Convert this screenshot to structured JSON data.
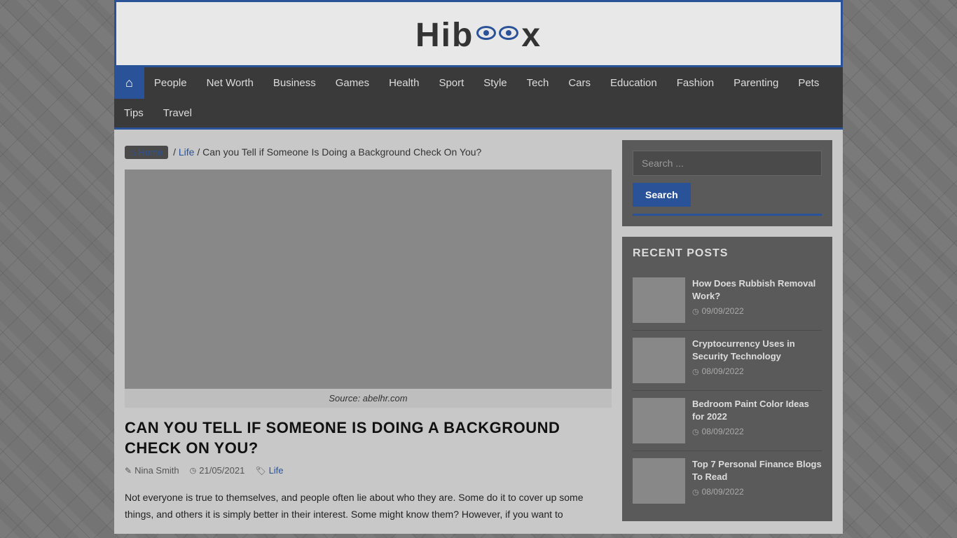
{
  "site": {
    "name_before": "Hib",
    "name_after": "x",
    "tagline": "Hiboox"
  },
  "nav": {
    "home_label": "Home",
    "items": [
      {
        "label": "People",
        "href": "#"
      },
      {
        "label": "Net Worth",
        "href": "#"
      },
      {
        "label": "Business",
        "href": "#"
      },
      {
        "label": "Games",
        "href": "#"
      },
      {
        "label": "Health",
        "href": "#"
      },
      {
        "label": "Sport",
        "href": "#"
      },
      {
        "label": "Style",
        "href": "#"
      },
      {
        "label": "Tech",
        "href": "#"
      },
      {
        "label": "Cars",
        "href": "#"
      },
      {
        "label": "Education",
        "href": "#"
      },
      {
        "label": "Fashion",
        "href": "#"
      },
      {
        "label": "Parenting",
        "href": "#"
      },
      {
        "label": "Pets",
        "href": "#"
      },
      {
        "label": "Tips",
        "href": "#"
      },
      {
        "label": "Travel",
        "href": "#"
      }
    ]
  },
  "breadcrumb": {
    "home": "Home",
    "category": "Life",
    "page": "Can you Tell if Someone Is Doing a Background Check On You?"
  },
  "article": {
    "title": "Can You Tell If Someone Is Doing A Background Check On You?",
    "image_caption": "Source: abelhr.com",
    "author": "Nina Smith",
    "date": "21/05/2021",
    "category": "Life",
    "excerpt": "Not everyone is true to themselves, and people often lie about who they are. Some do it to cover up some things, and others it is simply better in their interest. Some might know them? However, if you want to"
  },
  "sidebar": {
    "search": {
      "placeholder": "Search ...",
      "button_label": "Search"
    },
    "recent_posts": {
      "title": "Recent Posts",
      "items": [
        {
          "title": "How Does Rubbish Removal Work?",
          "date": "09/09/2022"
        },
        {
          "title": "Cryptocurrency Uses in Security Technology",
          "date": "08/09/2022"
        },
        {
          "title": "Bedroom Paint Color Ideas for 2022",
          "date": "08/09/2022"
        },
        {
          "title": "Top 7 Personal Finance Blogs To Read",
          "date": "08/09/2022"
        }
      ]
    }
  }
}
